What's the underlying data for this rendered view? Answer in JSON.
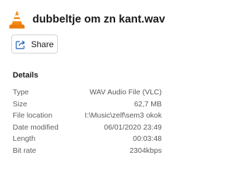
{
  "header": {
    "icon": "vlc-cone-icon",
    "file_name": "dubbeltje om zn kant.wav"
  },
  "share_button": {
    "icon": "share-icon",
    "label": "Share"
  },
  "details": {
    "heading": "Details",
    "rows": [
      {
        "label": "Type",
        "value": "WAV Audio File (VLC)"
      },
      {
        "label": "Size",
        "value": "62,7 MB"
      },
      {
        "label": "File location",
        "value": "I:\\Music\\zelf\\sem3 okok"
      },
      {
        "label": "Date modified",
        "value": "06/01/2020 23:49"
      },
      {
        "label": "Length",
        "value": "00:03:48"
      },
      {
        "label": "Bit rate",
        "value": "2304kbps"
      }
    ]
  },
  "colors": {
    "vlc_orange": "#f28a12",
    "accent_blue": "#1a5fb4",
    "label_gray": "#5f5f5f"
  }
}
